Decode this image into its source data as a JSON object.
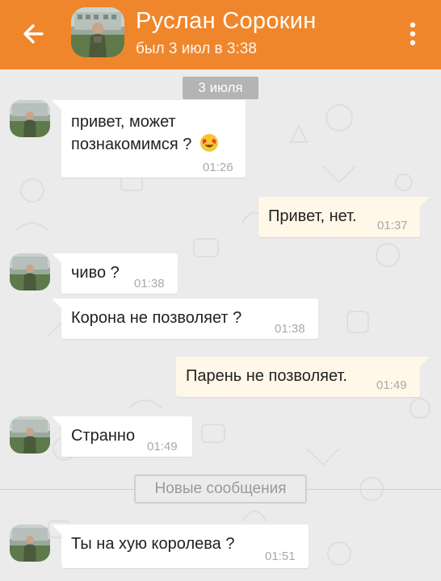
{
  "header": {
    "name": "Руслан Сорокин",
    "status": "был 3 июл в 3:38"
  },
  "chat": {
    "date_chip": "3 июля",
    "new_messages_label": "Новые сообщения",
    "messages": [
      {
        "dir": "in",
        "text_line1": "привет, может",
        "text_line2": "познакомимся ?",
        "emoji": "smiling-face-with-heart-eyes",
        "time": "01:26"
      },
      {
        "dir": "out",
        "text": "Привет, нет.",
        "time": "01:37"
      },
      {
        "dir": "in",
        "text": "чиво ?",
        "time": "01:38"
      },
      {
        "dir": "in",
        "text": "Корона не позволяет ?",
        "time": "01:38"
      },
      {
        "dir": "out",
        "text": "Парень не позволяет.",
        "time": "01:49"
      },
      {
        "dir": "in",
        "text": "Странно",
        "time": "01:49"
      },
      {
        "dir": "in",
        "text": "Ты на хую королева ?",
        "time": "01:51"
      }
    ]
  },
  "colors": {
    "header_orange": "#f0862c",
    "outgoing_bubble": "#fff7e8",
    "incoming_bubble": "#ffffff",
    "chat_background": "#ebebeb"
  },
  "icons": {
    "back": "arrow-left-icon",
    "menu": "vertical-dots-icon"
  }
}
